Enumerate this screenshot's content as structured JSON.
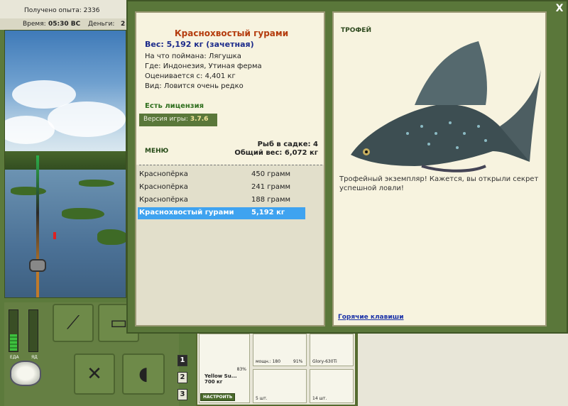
{
  "status": {
    "experience_label": "Получено опыта: 2336",
    "time_label": "Время:",
    "time_value": "05:30 ВС",
    "money_label": "Деньги:",
    "money_value": "2"
  },
  "meters": {
    "food_label": "ЕДА",
    "poison_label": "ЯД",
    "food_level": 0.4,
    "poison_level": 0.0
  },
  "slots": [
    "1",
    "2",
    "3"
  ],
  "inventory": {
    "rod_percent": "83%",
    "rod_name": "Yellow Su...",
    "rod_weight": "700 кг",
    "setup_label": "НАСТРОИТЬ",
    "reel_power": "мощн.: 180",
    "reel_percent": "91%",
    "line_name": "Glory-630Ti",
    "hooks_count": "5 шт.",
    "bait_count": "14 шт."
  },
  "fish_card": {
    "name": "Краснохвостый гурами",
    "weight": "Вес: 5,192 кг (зачетная)",
    "caught_on": "На что поймана: Лягушка",
    "location": "Где: Индонезия, Утиная ферма",
    "rated_from": "Оценивается с: 4,401 кг",
    "kind": "Вид: Ловится очень редко",
    "license": "Есть лицензия",
    "version_label": "Версия игры:",
    "version_value": "3.7.6",
    "menu": "МЕНЮ",
    "keep_count": "Рыб в садке: 4",
    "total_weight": "Общий вес: 6,072 кг"
  },
  "catch_list": [
    {
      "name": "Краснопёрка",
      "weight": "450 грамм"
    },
    {
      "name": "Краснопёрка",
      "weight": "241 грамм"
    },
    {
      "name": "Краснопёрка",
      "weight": "188 грамм"
    },
    {
      "name": "Краснохвостый гурами",
      "weight": "5,192 кг"
    }
  ],
  "trophy": {
    "title": "ТРОФЕЙ",
    "text": "Трофейный экземпляр! Кажется, вы открыли секрет успешной ловли!",
    "hotkeys": "Горячие клавиши"
  },
  "close_label": "X"
}
